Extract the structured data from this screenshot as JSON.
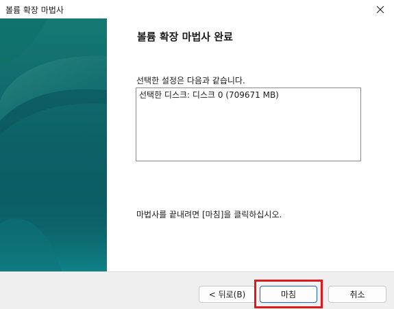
{
  "window": {
    "title": "볼륨 확장 마법사",
    "close_icon": "close-icon"
  },
  "sidebar": {
    "colors": {
      "dark": "#0b5d62",
      "light": "#0f8185",
      "highlight": "#3a8e8a"
    }
  },
  "main": {
    "heading": "볼륨 확장 마법사 완료",
    "intro": "선택한 설정은 다음과 같습니다.",
    "settings_lines": [
      "선택한 디스크: 디스크 0 (709671 MB)"
    ],
    "finish_hint": "마법사를 끝내려면 [마침]을 클릭하십시오."
  },
  "footer": {
    "back_label": "< 뒤로(B)",
    "finish_label": "마침",
    "cancel_label": "취소"
  },
  "colors": {
    "accent": "#1f5fbf",
    "highlight_box": "#e0181b",
    "footer_bg": "#f0f0f0"
  }
}
